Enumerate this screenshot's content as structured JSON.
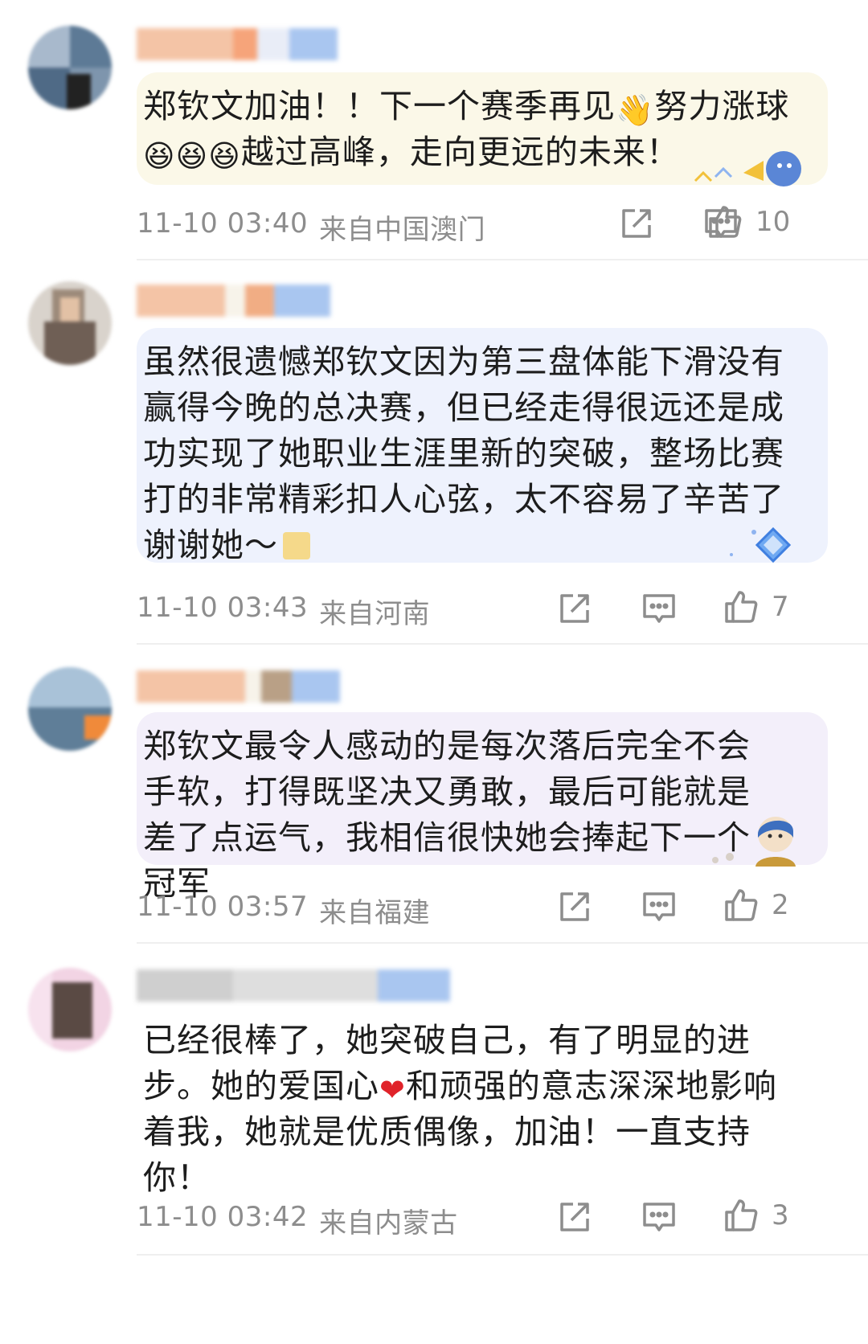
{
  "comments": [
    {
      "text": "郑钦文加油！！下一个赛季再见",
      "text_b": "努力涨球",
      "text_c": "越过高峰，走向更远的未来！",
      "time": "11-10 03:40",
      "location": "来自中国澳门",
      "likes": "10"
    },
    {
      "text": "虽然很遗憾郑钦文因为第三盘体能下滑没有赢得今晚的总决赛，但已经走得很远还是成功实现了她职业生涯里新的突破，整场比赛打的非常精彩扣人心弦，太不容易了辛苦了谢谢她～",
      "time": "11-10 03:43",
      "location": "来自河南",
      "likes": "7"
    },
    {
      "text": "郑钦文最令人感动的是每次落后完全不会手软，打得既坚决又勇敢，最后可能就是差了点运气，我相信很快她会捧起下一个冠军",
      "time": "11-10 03:57",
      "location": "来自福建",
      "likes": "2"
    },
    {
      "text": "已经很棒了，她突破自己，有了明显的进步。她的爱国心",
      "text_b": "和顽强的意志深深地影响着我，她就是优质偶像，加油！一直支持你！",
      "time": "11-10 03:42",
      "location": "来自内蒙古",
      "likes": "3"
    }
  ],
  "icons": {
    "share": "share-icon",
    "reply": "reply-icon",
    "like": "thumbs-up-icon"
  },
  "colors": {
    "meta": "#8d8d8d",
    "divider": "#efefef",
    "bubble_1": "#fbf8e8",
    "bubble_2": "#eef2fd",
    "bubble_3": "#f3effa"
  }
}
